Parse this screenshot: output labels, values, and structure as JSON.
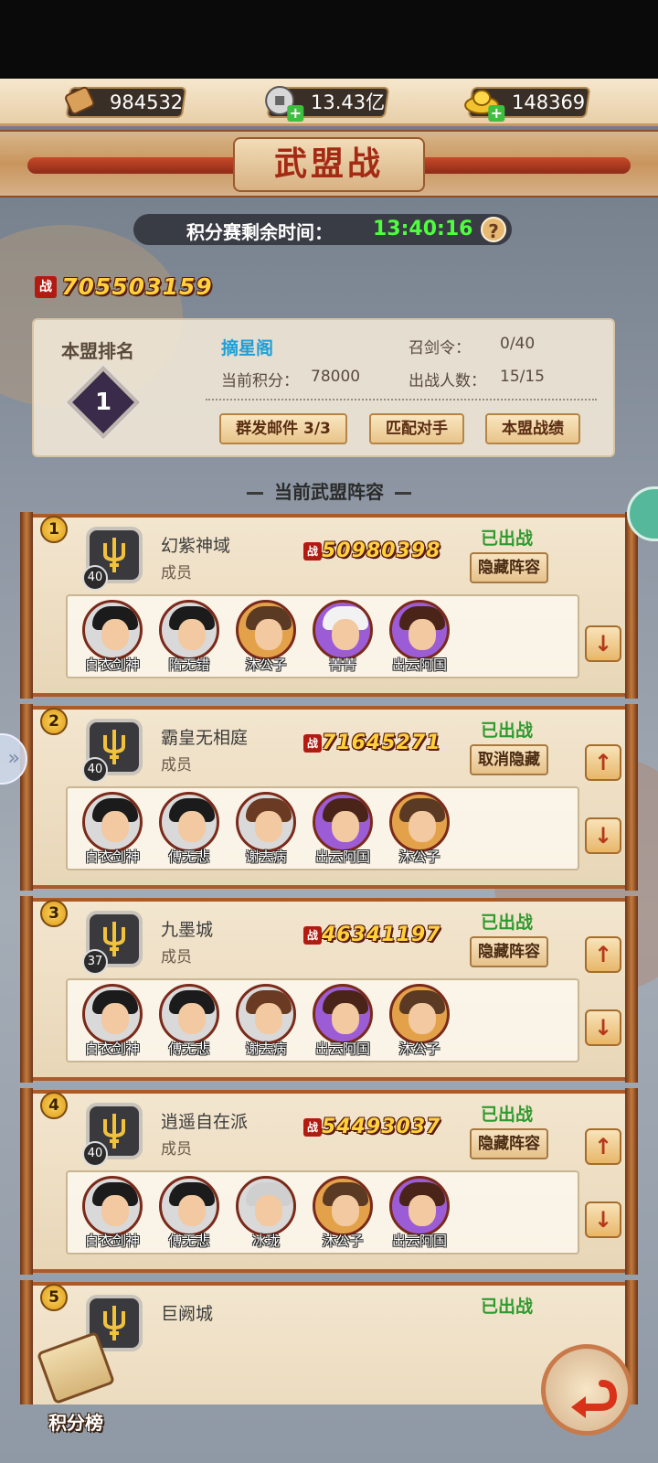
{
  "resources": {
    "items": [
      {
        "name": "scroll",
        "value": "984532"
      },
      {
        "name": "coin",
        "value": "13.43亿"
      },
      {
        "name": "gold-ingot",
        "value": "148369"
      }
    ]
  },
  "header": {
    "title": "武盟战"
  },
  "timer": {
    "label": "积分赛剩余时间：",
    "value": "13:40:16",
    "help": "?"
  },
  "total_power": {
    "icon_text": "战",
    "value": "705503159"
  },
  "alliance_info": {
    "rank_label": "本盟排名",
    "rank": "1",
    "name": "摘星阁",
    "score_label": "当前积分：",
    "score": "78000",
    "token_label": "召剑令：",
    "token": "0/40",
    "members_label": "出战人数：",
    "members": "15/15",
    "buttons": {
      "mail": "群发邮件 3/3",
      "match": "匹配对手",
      "record": "本盟战绩"
    }
  },
  "lineup_title": "当前武盟阵容",
  "members": [
    {
      "index": "1",
      "level": "40",
      "name": "幻紫神域",
      "role": "成员",
      "power": "50980398",
      "status": "已出战",
      "action": "隐藏阵容",
      "heroes": [
        "白衣剑神",
        "隋无错",
        "沐公子",
        "菁菁",
        "出云阿国"
      ]
    },
    {
      "index": "2",
      "level": "40",
      "name": "霸皇无相庭",
      "role": "成员",
      "power": "71645271",
      "status": "已出战",
      "action": "取消隐藏",
      "heroes": [
        "白衣剑神",
        "傅无悲",
        "谢去病",
        "出云阿国",
        "沐公子"
      ]
    },
    {
      "index": "3",
      "level": "37",
      "name": "九墨城",
      "role": "成员",
      "power": "46341197",
      "status": "已出战",
      "action": "隐藏阵容",
      "heroes": [
        "白衣剑神",
        "傅无悲",
        "谢去病",
        "出云阿国",
        "沐公子"
      ]
    },
    {
      "index": "4",
      "level": "40",
      "name": "逍遥自在派",
      "role": "成员",
      "power": "54493037",
      "status": "已出战",
      "action": "隐藏阵容",
      "heroes": [
        "白衣剑神",
        "傅无悲",
        "冰珑",
        "沐公子",
        "出云阿国"
      ]
    },
    {
      "index": "5",
      "name": "巨阙城",
      "status": "已出战"
    }
  ],
  "bottom": {
    "rank_button": "积分榜"
  },
  "colors": {
    "accent_green": "#2f9a2f",
    "timer_green": "#4dff3c",
    "alliance_blue": "#1f9fd6",
    "title_red": "#a42a14"
  }
}
